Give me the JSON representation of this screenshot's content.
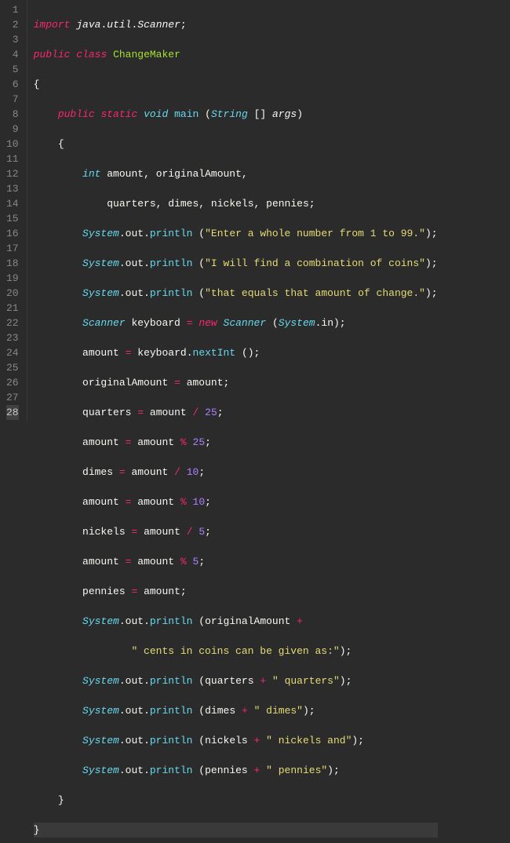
{
  "lineNumbers": [
    "1",
    "2",
    "3",
    "4",
    "5",
    "6",
    "7",
    "8",
    "9",
    "10",
    "11",
    "12",
    "13",
    "14",
    "15",
    "16",
    "17",
    "18",
    "19",
    "20",
    "21",
    "22",
    "23",
    "24",
    "25",
    "26",
    "27",
    "28"
  ],
  "activeLine": 28,
  "kw": {
    "import": "import",
    "public": "public",
    "class": "class",
    "static": "static",
    "new": "new"
  },
  "type": {
    "void": "void",
    "int": "int",
    "String": "String",
    "Scanner": "Scanner",
    "System": "System"
  },
  "ident": {
    "java": "java",
    "util": "util",
    "ScannerName": "Scanner",
    "ChangeMaker": "ChangeMaker",
    "main": "main",
    "args": "args",
    "out": "out",
    "println": "println",
    "in": "in",
    "keyboard": "keyboard",
    "nextInt": "nextInt",
    "amount": "amount",
    "originalAmount": "originalAmount",
    "quarters": "quarters",
    "dimes": "dimes",
    "nickels": "nickels",
    "pennies": "pennies"
  },
  "str": {
    "prompt1": "\"Enter a whole number from 1 to 99.\"",
    "prompt2": "\"I will find a combination of coins\"",
    "prompt3": "\"that equals that amount of change.\"",
    "centsMsg": "\" cents in coins can be given as:\"",
    "quartersMsg": "\" quarters\"",
    "dimesMsg": "\" dimes\"",
    "nickelsMsg": "\" nickels and\"",
    "penniesMsg": "\" pennies\""
  },
  "num": {
    "n25": "25",
    "n10": "10",
    "n5": "5"
  }
}
